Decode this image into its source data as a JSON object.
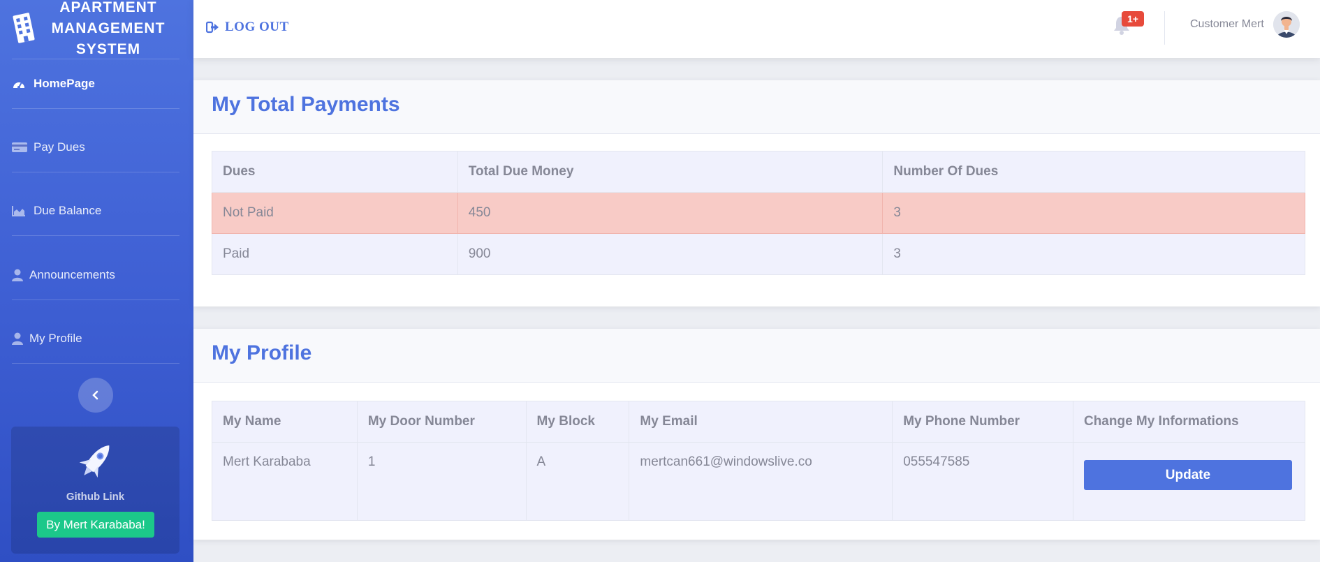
{
  "sidebar": {
    "brand_lines": [
      "APARTMENT",
      "MANAGEMENT",
      "SYSTEM"
    ],
    "items": [
      {
        "label": "HomePage",
        "icon": "tachometer-icon",
        "active": true
      },
      {
        "label": "Pay Dues",
        "icon": "credit-card-icon"
      },
      {
        "label": "Due Balance",
        "icon": "area-chart-icon"
      },
      {
        "label": "Announcements",
        "icon": "user-icon"
      },
      {
        "label": "My Profile",
        "icon": "user-icon"
      }
    ],
    "toggle_icon": "chevron-left-icon",
    "promo": {
      "text": "Github Link",
      "button": "By Mert Karababa!"
    }
  },
  "topbar": {
    "logout": "LOG OUT",
    "alert_badge": "1+",
    "user_name": "Customer Mert"
  },
  "payments": {
    "title": "My Total Payments",
    "headers": [
      "Dues",
      "Total Due Money",
      "Number Of Dues"
    ],
    "rows": [
      [
        "Not Paid",
        "450",
        "3"
      ],
      [
        "Paid",
        "900",
        "3"
      ]
    ]
  },
  "profile": {
    "title": "My Profile",
    "headers": [
      "My Name",
      "My Door Number",
      "My Block",
      "My Email",
      "My Phone Number",
      "Change My Informations"
    ],
    "row": [
      "Mert Karababa",
      "1",
      "A",
      "mertcan661@windowslive.co",
      "055547585"
    ],
    "update_button": "Update"
  },
  "colors": {
    "primary": "#4e73df",
    "success": "#1cc88a",
    "danger": "#e74a3b",
    "danger_row": "#f8cbc6"
  }
}
